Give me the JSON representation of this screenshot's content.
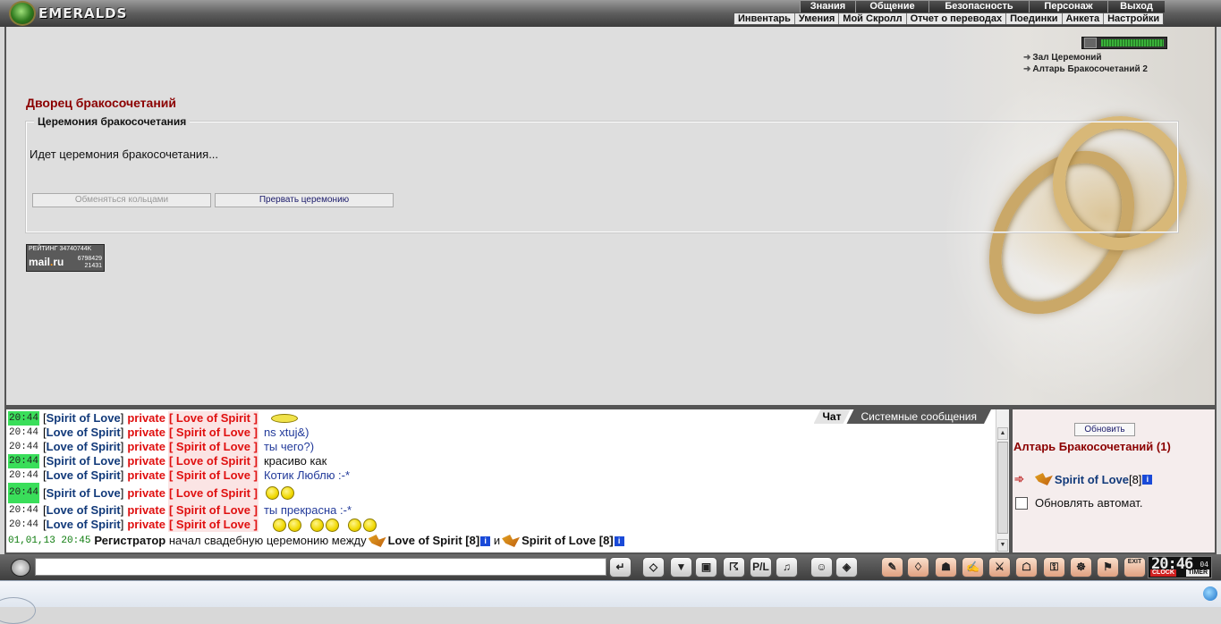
{
  "logo": {
    "name": "EMERALDS"
  },
  "top_menu": [
    "Знания",
    "Общение",
    "Безопасность",
    "Персонаж",
    "Выход"
  ],
  "sub_menu": [
    "Инвентарь",
    "Умения",
    "Мой Скролл",
    "Отчет о переводах",
    "Поединки",
    "Анкета",
    "Настройки"
  ],
  "locations": [
    "Зал Церемоний",
    "Алтарь Бракосочетаний 2"
  ],
  "main": {
    "title": "Дворец бракосочетаний",
    "ceremony_legend": "Церемония бракосочетания",
    "status_text": "Идет церемония бракосочетания...",
    "btn_exchange_rings": "Обменяться кольцами",
    "btn_stop_ceremony": "Прервать церемонию"
  },
  "counter": {
    "label": "РЕЙТИНГ",
    "top_numbers": "34740744K",
    "brand": "mail",
    "brand_suffix": "ru",
    "n1": "6798429",
    "n2": "21431"
  },
  "chat": {
    "tabs": [
      "Чат",
      "Системные сообщения"
    ],
    "private_word": "private",
    "messages": [
      {
        "time": "20:44",
        "from": "Spirit of Love",
        "to": "Love of Spirit",
        "text": ""
      },
      {
        "time": "20:44",
        "from": "Love of Spirit",
        "to": "Spirit of Love",
        "text": "ns xtuj&)"
      },
      {
        "time": "20:44",
        "from": "Love of Spirit",
        "to": "Spirit of Love",
        "text": "ты чего?)"
      },
      {
        "time": "20:44",
        "from": "Spirit of Love",
        "to": "Love of Spirit",
        "text": "красиво как"
      },
      {
        "time": "20:44",
        "from": "Love of Spirit",
        "to": "Spirit of Love",
        "text": "Котик Люблю :-*"
      },
      {
        "time": "20:44",
        "from": "Spirit of Love",
        "to": "Love of Spirit",
        "text": ""
      },
      {
        "time": "20:44",
        "from": "Love of Spirit",
        "to": "Spirit of Love",
        "text": "ты прекрасна :-*"
      },
      {
        "time": "20:44",
        "from": "Love of Spirit",
        "to": "Spirit of Love",
        "text": ""
      }
    ],
    "system": {
      "datetime": "01,01,13 20:45",
      "actor": "Регистратор",
      "text": "начал свадебную церемонию между",
      "user1": "Love of Spirit",
      "user1_level": "[8]",
      "and_word": "и",
      "user2": "Spirit of Love",
      "user2_level": "[8]",
      "info": "i"
    }
  },
  "side": {
    "refresh_label": "Обновить",
    "room_title": "Алтарь Бракосочетаний (1)",
    "user_name": "Spirit of Love",
    "user_level": "[8]",
    "info": "i",
    "auto_refresh_label": "Обновлять автомат."
  },
  "toolbar": {
    "input_value": "",
    "pl_label": "P/L",
    "exit_label": "EXIT"
  },
  "clock": {
    "time": "20:46",
    "seconds": "04",
    "clock_label": "CLOCK",
    "timer_label": "TIMER"
  },
  "colors": {
    "title_red": "#8b0000",
    "private_red": "#e01010",
    "user_blue": "#123a7a",
    "time_highlight": "#3ade5a"
  }
}
